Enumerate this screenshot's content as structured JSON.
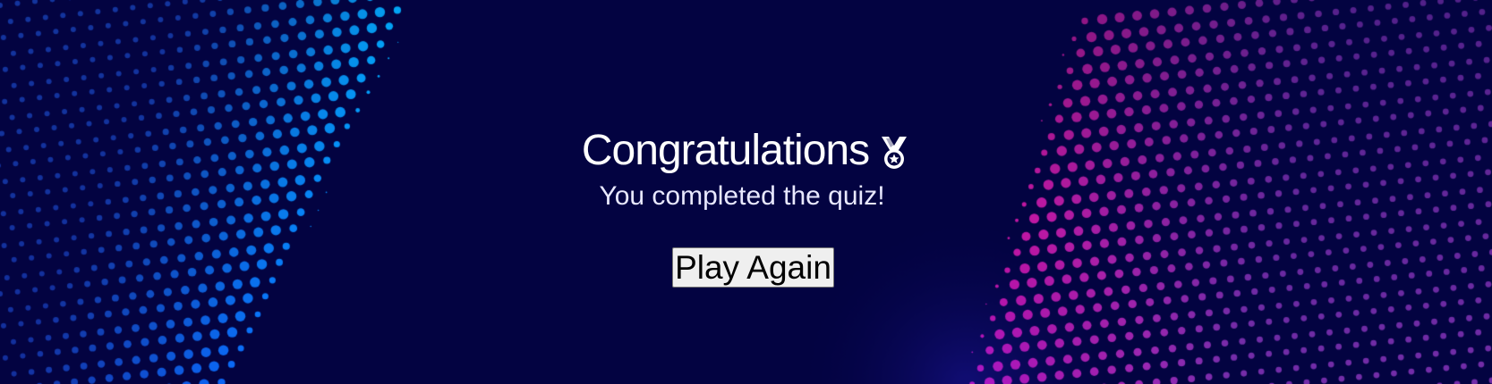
{
  "screen": {
    "background_color": "#030341",
    "dot_colors": {
      "left_wave": [
        "#00b4ff",
        "#0a6cff",
        "#1e3fbf"
      ],
      "right_wave": [
        "#ff14c8",
        "#d21ea0",
        "#9a3ccc"
      ]
    }
  },
  "result": {
    "title": "Congratulations",
    "title_icon": "medal-icon",
    "subtitle": "You completed the quiz!"
  },
  "actions": {
    "play_again_label": "Play Again"
  }
}
